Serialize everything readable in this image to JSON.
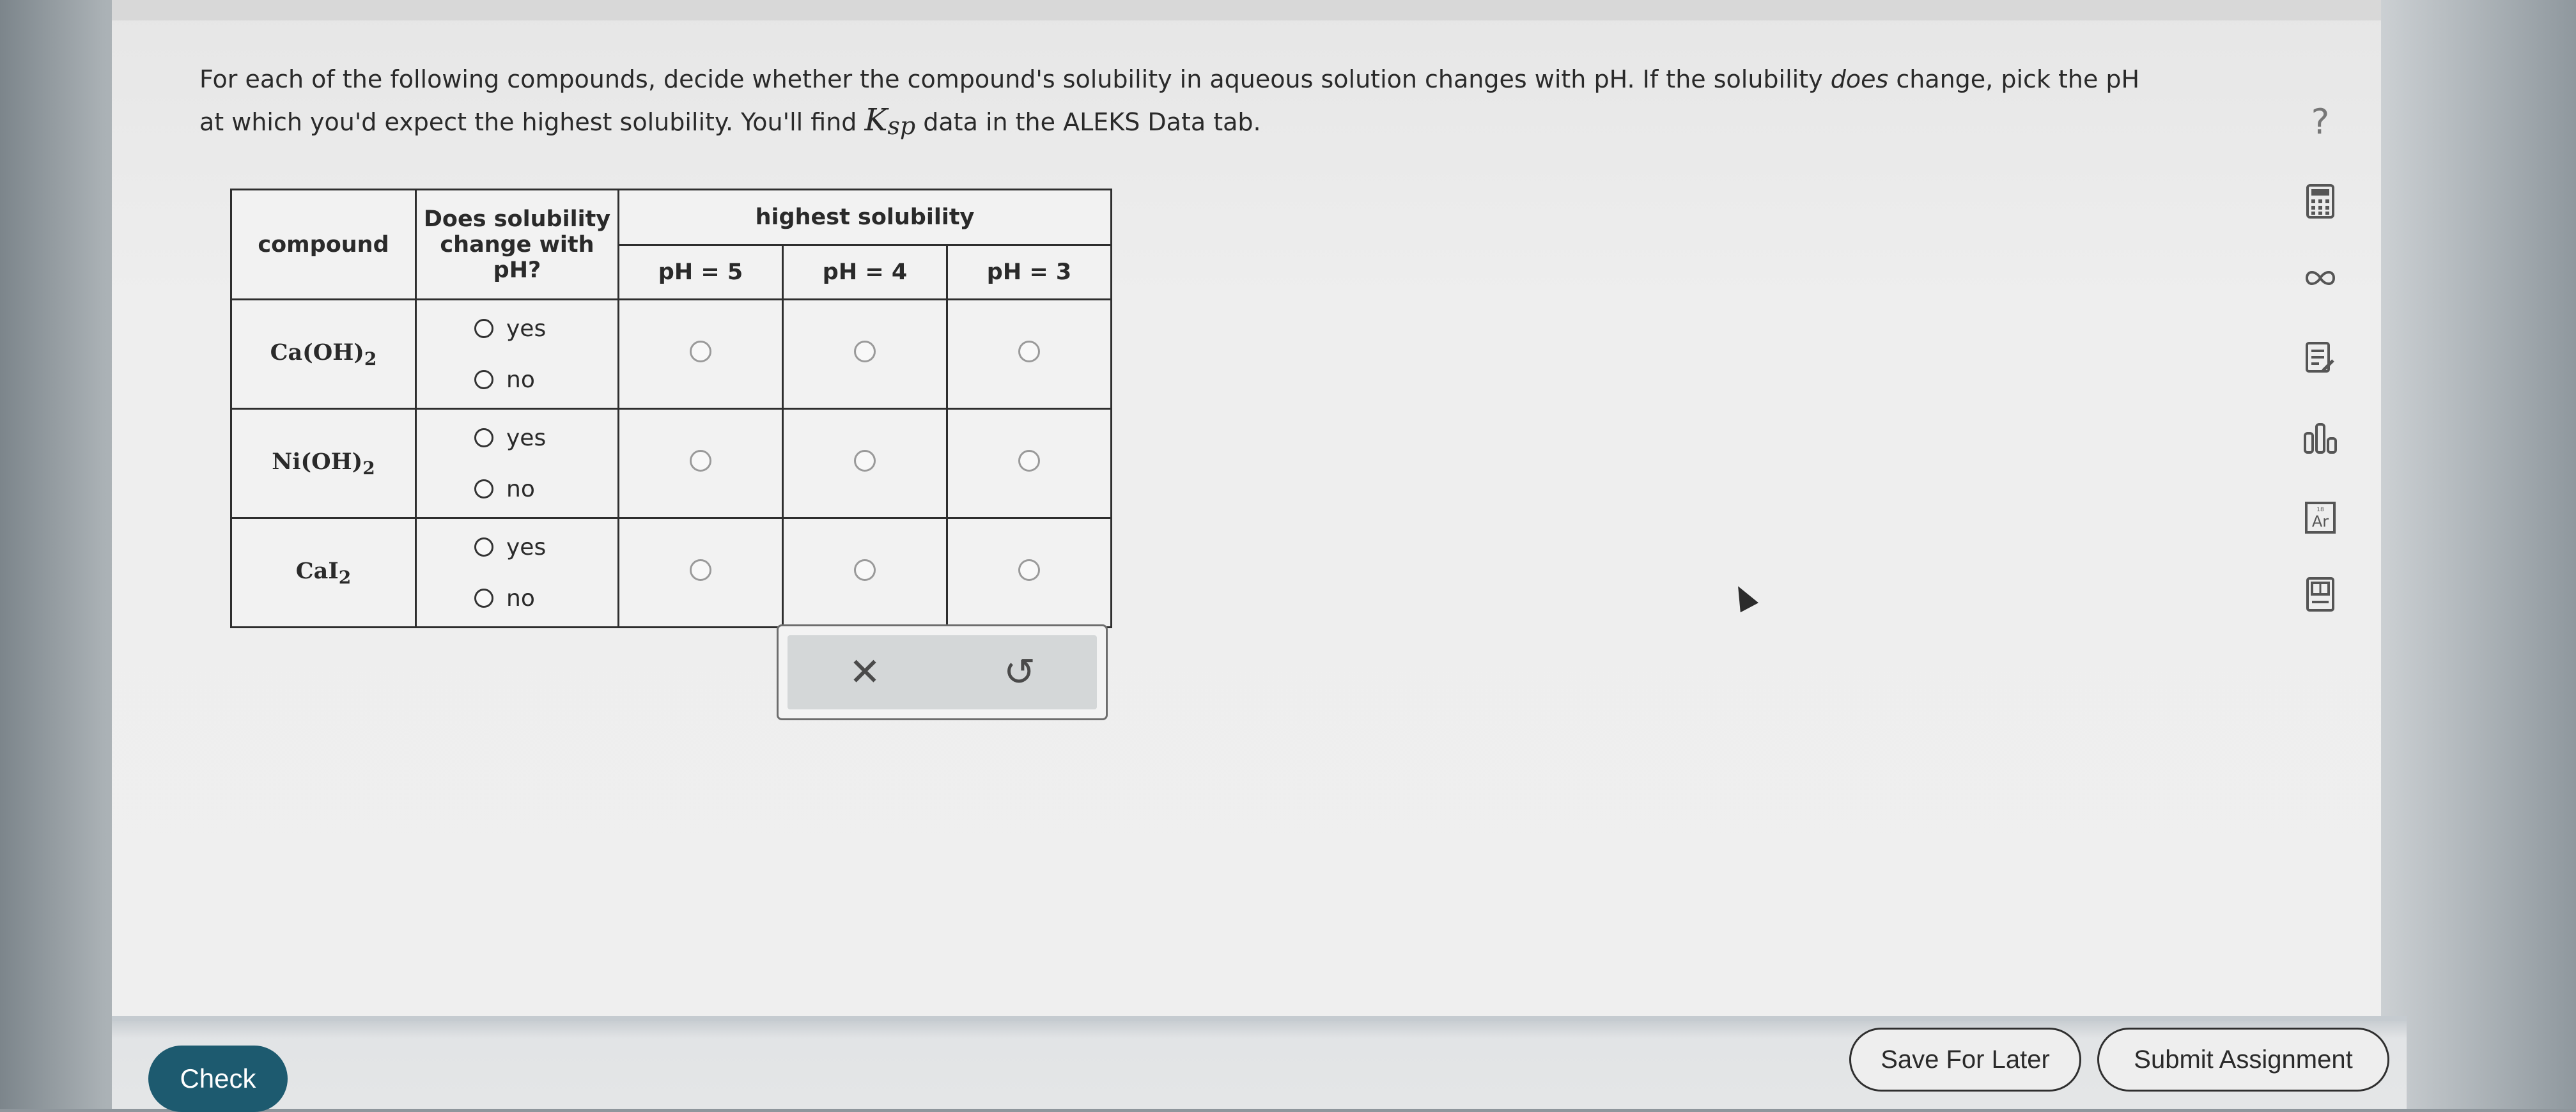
{
  "question": {
    "line1_pre": "For each of the following compounds, decide whether the compound's solubility in aqueous solution changes with pH. If the solubility ",
    "line1_em": "does",
    "line1_post": " change, pick the pH",
    "line2_pre": "at which you'd expect the highest solubility. You'll find ",
    "ksp_main": "K",
    "ksp_sub": "sp",
    "line2_post": " data in the ALEKS Data tab."
  },
  "table": {
    "header_compound": "compound",
    "header_change": "Does solubility change with pH?",
    "header_highest": "highest solubility",
    "ph_columns": [
      "pH = 5",
      "pH = 4",
      "pH = 3"
    ],
    "option_yes": "yes",
    "option_no": "no",
    "rows": [
      {
        "main": "Ca(OH)",
        "sub": "2"
      },
      {
        "main": "Ni(OH)",
        "sub": "2"
      },
      {
        "main": "CaI",
        "sub": "2"
      }
    ]
  },
  "actions": {
    "clear_glyph": "✕",
    "undo_glyph": "↺"
  },
  "toolbar": {
    "help": "?",
    "icons": [
      "calculator-icon",
      "infinity-icon",
      "notes-icon",
      "bar-chart-icon",
      "periodic-table-icon",
      "data-table-icon"
    ]
  },
  "footer": {
    "check": "Check",
    "save": "Save For Later",
    "submit": "Submit Assignment"
  },
  "colors": {
    "check_button": "#1d5a6f",
    "panel": "#eeeeee",
    "border": "#2e2e2e"
  }
}
